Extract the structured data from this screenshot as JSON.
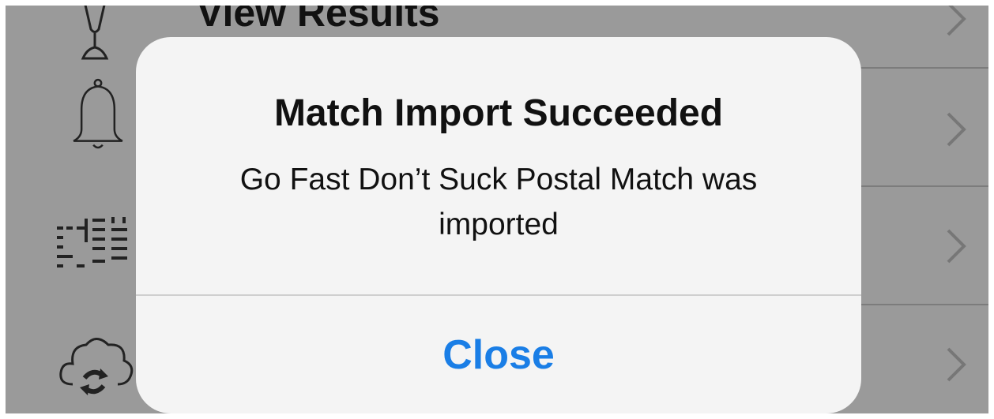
{
  "background_menu": {
    "items": [
      {
        "label": "View Results",
        "icon": "trophy-icon"
      },
      {
        "label": "",
        "icon": "bell-icon"
      },
      {
        "label": "",
        "icon": "scoreboard-icon"
      },
      {
        "label": "",
        "icon": "cloud-sync-icon"
      }
    ]
  },
  "alert": {
    "title": "Match Import Succeeded",
    "message": "Go Fast Don’t Suck Postal Match was imported",
    "button_label": "Close",
    "button_color": "#1a7ee6"
  },
  "colors": {
    "dim_overlay": "#9a9a9a",
    "alert_background": "#f4f4f4"
  }
}
